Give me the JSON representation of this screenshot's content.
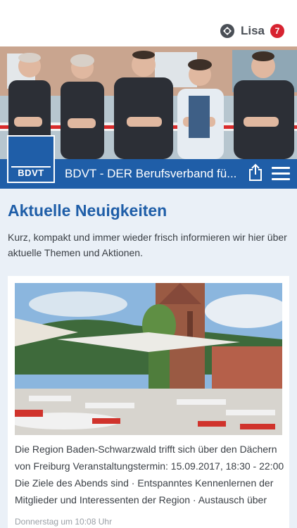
{
  "topbar": {
    "user_name": "Lisa",
    "notification_count": "7"
  },
  "brand": {
    "logo_text": "BDVT",
    "title": "BDVT - DER Berufsverband fü..."
  },
  "main": {
    "heading": "Aktuelle Neuigkeiten",
    "intro": "Kurz, kompakt und immer wieder frisch informieren wir hier über aktuelle Themen und Aktionen."
  },
  "news": [
    {
      "text": "Die Region Baden-Schwarzwald trifft sich über den Dächern von Freiburg Veranstaltungstermin: 15.09.2017, 18:30 - 22:00 Die Ziele des Abends sind · Entspanntes Kennenlernen der Mitglieder und Interessenten der Region · Austausch über",
      "date": "Donnerstag um 10:08 Uhr"
    }
  ],
  "colors": {
    "brand_blue": "#1f5ea8",
    "badge_red": "#d72330",
    "background": "#eaf0f7"
  }
}
